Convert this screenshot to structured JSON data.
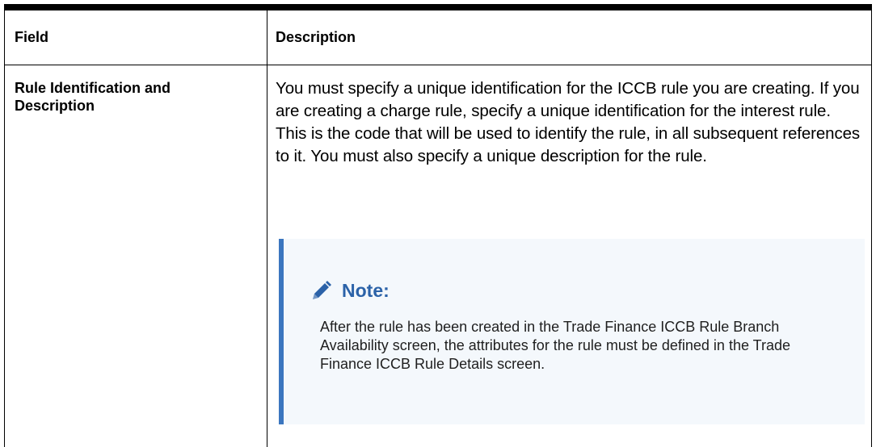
{
  "table": {
    "headers": {
      "field": "Field",
      "description": "Description"
    },
    "rows": [
      {
        "field": "Rule Identification and Description",
        "description": "You must specify a unique identification for the ICCB rule you are creating. If you are creating a charge rule, specify a unique identification for the interest rule. This is the code that will be used to identify the rule, in all subsequent references to it. You must also specify a unique description for the rule.",
        "note": {
          "icon": "pencil-icon",
          "title": "Note:",
          "text": "After the rule has been created in the Trade Finance ICCB Rule Branch Availability screen, the attributes for the rule must be defined in the Trade Finance ICCB Rule Details screen."
        }
      }
    ]
  },
  "colors": {
    "border": "#000000",
    "note_accent": "#3b76bf",
    "note_title": "#2b62a8",
    "note_background": "#f4f8fc"
  }
}
